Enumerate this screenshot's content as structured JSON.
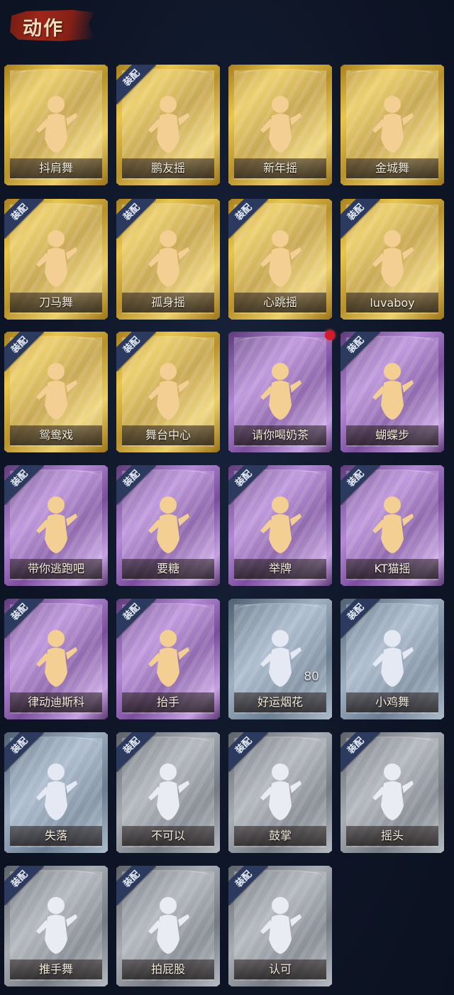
{
  "header": {
    "title": "动作"
  },
  "equipped_label": "装配",
  "tier_colors": {
    "gold": "#e0bd4a",
    "purple": "#a47bc6",
    "blue": "#8ea1b5",
    "grey": "#9aa0a8"
  },
  "actions": [
    {
      "name": "抖肩舞",
      "tier": "gold",
      "equipped": false,
      "icon": "dancer-shrug-icon"
    },
    {
      "name": "鹏友摇",
      "tier": "gold",
      "equipped": true,
      "icon": "dancer-wave-icon"
    },
    {
      "name": "新年摇",
      "tier": "gold",
      "equipped": false,
      "icon": "dancer-music-icon"
    },
    {
      "name": "金城舞",
      "tier": "gold",
      "equipped": false,
      "icon": "dancer-sparkle-icon"
    },
    {
      "name": "刀马舞",
      "tier": "gold",
      "equipped": true,
      "icon": "dancer-pose-icon"
    },
    {
      "name": "孤身摇",
      "tier": "gold",
      "equipped": true,
      "icon": "dancer-swing-icon"
    },
    {
      "name": "心跳摇",
      "tier": "gold",
      "equipped": true,
      "icon": "dancer-heartbeat-icon"
    },
    {
      "name": "luvaboy",
      "tier": "gold",
      "equipped": true,
      "icon": "dancer-luvaboy-icon"
    },
    {
      "name": "鸳鸯戏",
      "tier": "gold",
      "equipped": true,
      "icon": "dancer-duet-icon"
    },
    {
      "name": "舞台中心",
      "tier": "gold",
      "equipped": true,
      "icon": "dancer-center-icon"
    },
    {
      "name": "请你喝奶茶",
      "tier": "purple",
      "equipped": false,
      "icon": "milk-tea-icon",
      "new": true
    },
    {
      "name": "蝴蝶步",
      "tier": "purple",
      "equipped": true,
      "icon": "butterfly-step-icon"
    },
    {
      "name": "带你逃跑吧",
      "tier": "purple",
      "equipped": true,
      "icon": "run-away-icon"
    },
    {
      "name": "要糖",
      "tier": "purple",
      "equipped": true,
      "icon": "ask-candy-icon"
    },
    {
      "name": "举牌",
      "tier": "purple",
      "equipped": true,
      "icon": "hold-sign-icon"
    },
    {
      "name": "KT猫摇",
      "tier": "purple",
      "equipped": true,
      "icon": "cat-sway-icon"
    },
    {
      "name": "律动迪斯科",
      "tier": "purple",
      "equipped": true,
      "icon": "disco-icon"
    },
    {
      "name": "抬手",
      "tier": "purple",
      "equipped": true,
      "icon": "raise-hand-icon"
    },
    {
      "name": "好运烟花",
      "tier": "blue",
      "equipped": false,
      "icon": "firework-icon",
      "count": "80"
    },
    {
      "name": "小鸡舞",
      "tier": "blue",
      "equipped": true,
      "icon": "chicken-dance-icon"
    },
    {
      "name": "失落",
      "tier": "blue",
      "equipped": true,
      "icon": "crawl-sad-icon"
    },
    {
      "name": "不可以",
      "tier": "grey",
      "equipped": true,
      "icon": "finger-no-icon"
    },
    {
      "name": "鼓掌",
      "tier": "grey",
      "equipped": true,
      "icon": "clap-icon"
    },
    {
      "name": "摇头",
      "tier": "grey",
      "equipped": true,
      "icon": "shake-head-icon"
    },
    {
      "name": "推手舞",
      "tier": "grey",
      "equipped": true,
      "icon": "push-hands-icon"
    },
    {
      "name": "拍屁股",
      "tier": "grey",
      "equipped": true,
      "icon": "slap-butt-icon"
    },
    {
      "name": "认可",
      "tier": "grey",
      "equipped": true,
      "icon": "thumbs-up-icon"
    }
  ]
}
